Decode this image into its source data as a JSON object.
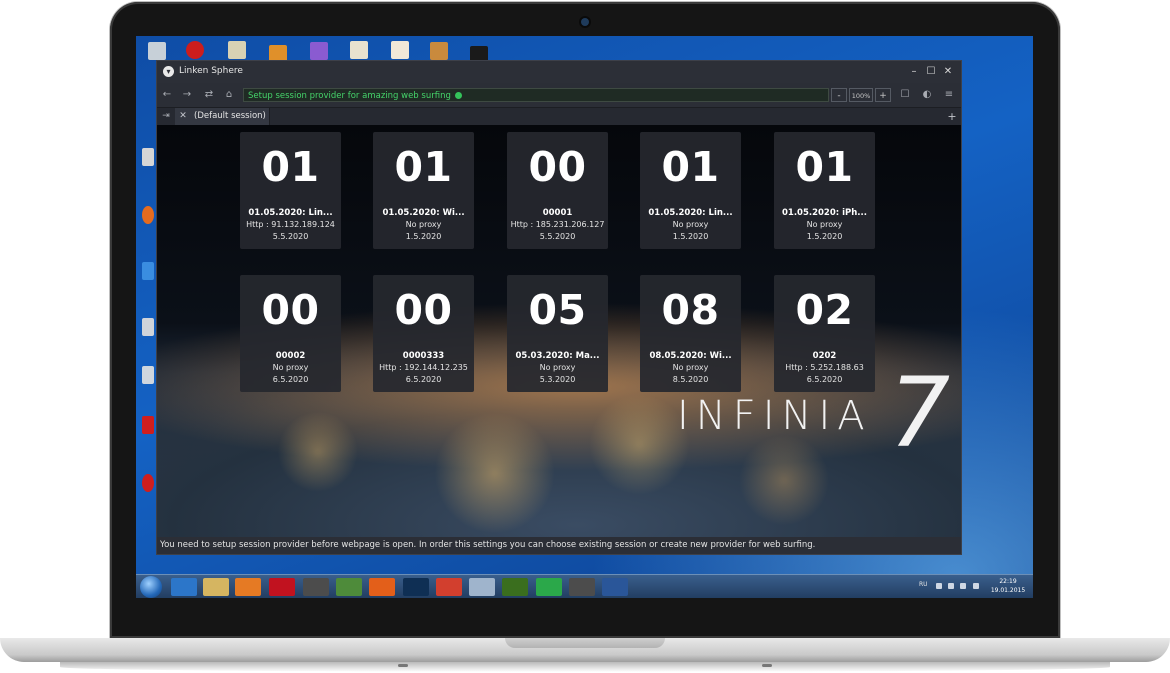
{
  "window": {
    "title": "Linken Sphere",
    "minimize": "–",
    "maximize": "☐",
    "close": "✕"
  },
  "navbar": {
    "back": "←",
    "forward": "→",
    "reload": "⇄",
    "home": "⌂",
    "address_text": "Setup session provider for amazing web surfing",
    "zoom_minus": "-",
    "zoom_value": "100%",
    "zoom_plus": "+",
    "bookmark": "☐",
    "extension": "◐",
    "menu": "≡"
  },
  "tabs": {
    "side_button": "⇥",
    "items": [
      {
        "close": "✕",
        "label": "(Default session)"
      }
    ],
    "new_tab": "+"
  },
  "sessions": [
    {
      "number": "01",
      "name": "01.05.2020: Lin...",
      "proxy": "Http : 91.132.189.124",
      "date": "5.5.2020"
    },
    {
      "number": "01",
      "name": "01.05.2020: Wi...",
      "proxy": "No proxy",
      "date": "1.5.2020"
    },
    {
      "number": "00",
      "name": "00001",
      "proxy": "Http : 185.231.206.127",
      "date": "5.5.2020"
    },
    {
      "number": "01",
      "name": "01.05.2020: Lin...",
      "proxy": "No proxy",
      "date": "1.5.2020"
    },
    {
      "number": "01",
      "name": "01.05.2020: iPh...",
      "proxy": "No proxy",
      "date": "1.5.2020"
    },
    {
      "number": "00",
      "name": "00002",
      "proxy": "No proxy",
      "date": "6.5.2020"
    },
    {
      "number": "00",
      "name": "0000333",
      "proxy": "Http : 192.144.12.235",
      "date": "6.5.2020"
    },
    {
      "number": "05",
      "name": "05.03.2020: Ma...",
      "proxy": "No proxy",
      "date": "5.3.2020"
    },
    {
      "number": "08",
      "name": "08.05.2020: Wi...",
      "proxy": "No proxy",
      "date": "8.5.2020"
    },
    {
      "number": "02",
      "name": "0202",
      "proxy": "Http : 5.252.188.63",
      "date": "6.5.2020"
    }
  ],
  "brand": {
    "word": "INFINIA",
    "number": "7"
  },
  "status_message": "You need to setup session provider before webpage is open. In order this settings you can choose existing session or create new provider for web surfing.",
  "taskbar": {
    "language": "RU",
    "time": "22:19",
    "date": "19.01.2015",
    "icons": [
      "ie-icon",
      "explorer-icon",
      "media-player-icon",
      "opera-icon",
      "tanks-icon",
      "winamp-icon",
      "firefox-icon",
      "photoshop-icon",
      "chrome-icon",
      "viewer-icon",
      "dreamweaver-icon",
      "at-icon",
      "tanks2-icon",
      "word-icon"
    ]
  },
  "colors": {
    "address_text": "#45d36a",
    "card_bg": "#26282e",
    "window_bg": "#2b2e36"
  }
}
